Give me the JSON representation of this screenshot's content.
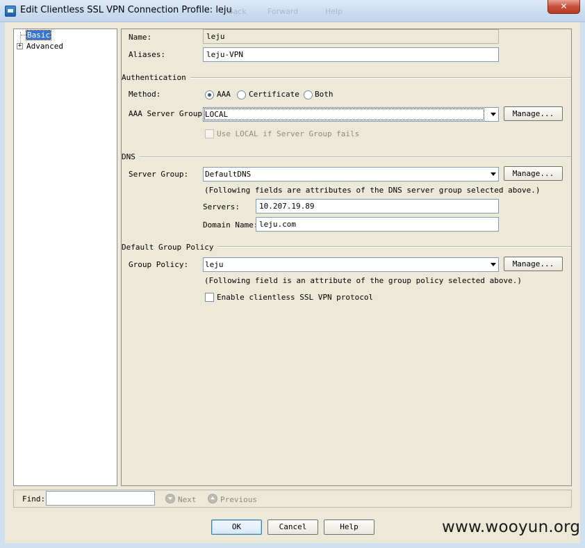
{
  "window": {
    "title": "Edit Clientless SSL VPN Connection Profile: leju",
    "ghost_back": "Back",
    "ghost_forward": "Forward",
    "ghost_help": "Help",
    "close_glyph": "✕"
  },
  "tree": {
    "items": [
      {
        "label": "Basic",
        "selected": true
      },
      {
        "label": "Advanced",
        "expander": "+"
      }
    ]
  },
  "basic": {
    "name_label": "Name:",
    "name_value": "leju",
    "aliases_label": "Aliases:",
    "aliases_value": "leju-VPN"
  },
  "authentication": {
    "section_title": "Authentication",
    "method_label": "Method:",
    "methods": [
      {
        "label": "AAA",
        "selected": true
      },
      {
        "label": "Certificate",
        "selected": false
      },
      {
        "label": "Both",
        "selected": false
      }
    ],
    "server_group_label": "AAA Server Group:",
    "server_group_value": "LOCAL",
    "manage_label": "Manage...",
    "fallback_label": "Use LOCAL if Server Group fails",
    "fallback_checked": false,
    "fallback_enabled": false
  },
  "dns": {
    "section_title": "DNS",
    "server_group_label": "Server Group:",
    "server_group_value": "DefaultDNS",
    "manage_label": "Manage...",
    "note": "(Following fields are attributes of the DNS server group selected above.)",
    "servers_label": "Servers:",
    "servers_value": "10.207.19.89",
    "domain_label": "Domain Name:",
    "domain_value": "leju.com"
  },
  "group_policy": {
    "section_title": "Default Group Policy",
    "policy_label": "Group Policy:",
    "policy_value": "leju",
    "manage_label": "Manage...",
    "note": "(Following field is an attribute of the group policy selected above.)",
    "enable_label": "Enable clientless SSL VPN protocol",
    "enable_checked": false
  },
  "find": {
    "label": "Find:",
    "value": "",
    "next_label": "Next",
    "previous_label": "Previous"
  },
  "buttons": {
    "ok": "OK",
    "cancel": "Cancel",
    "help": "Help"
  },
  "watermark": "www.wooyun.org"
}
